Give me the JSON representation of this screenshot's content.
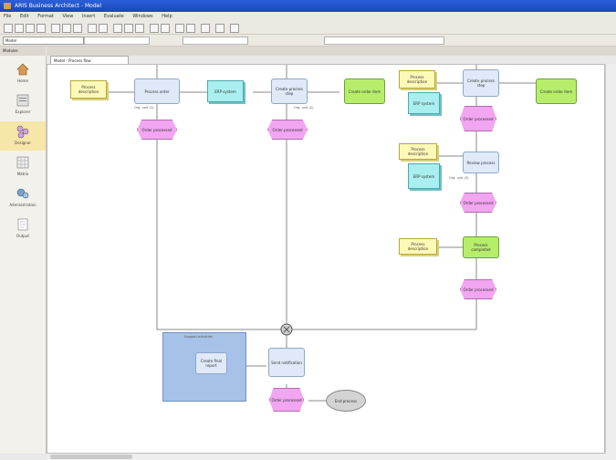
{
  "window": {
    "title": "ARIS Business Architect - Model"
  },
  "menu": [
    "File",
    "Edit",
    "Format",
    "View",
    "Insert",
    "Evaluate",
    "Windows",
    "Help"
  ],
  "address": {
    "value": "Model"
  },
  "sidebar": {
    "header": "Modules",
    "items": [
      {
        "label": "Home"
      },
      {
        "label": "Explorer"
      },
      {
        "label": "Designer"
      },
      {
        "label": "Matrix"
      },
      {
        "label": "Administration"
      },
      {
        "label": "Output"
      }
    ]
  },
  "tab": {
    "label": "Model - Process flow"
  },
  "diagram": {
    "func1": "Process order",
    "func2": "Create process step",
    "func3": "Create process step",
    "func4": "Review process",
    "func5": "Process completed",
    "func6": "Create final report",
    "func7": "Send notification",
    "doc": "Process description",
    "sys": "ERP system",
    "grn": "Create order item",
    "evt": "Order processed",
    "group": "Support activities",
    "term": "End process",
    "note1": "Org. unit (1)",
    "note2": "Org. unit (2)",
    "note3": "Org. unit (3)"
  }
}
